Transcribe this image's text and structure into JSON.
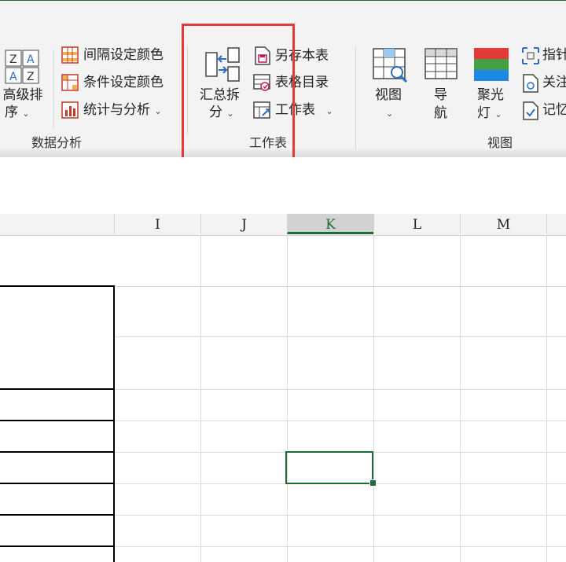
{
  "ribbon": {
    "groups": {
      "data_analysis": {
        "label": "数据分析",
        "sort": {
          "label_line1": "高级排",
          "label_line2": "序",
          "chevron": "⌄",
          "icon": "sort-az-icon"
        },
        "items": [
          {
            "label": "间隔设定颜色",
            "icon": "interval-color-icon"
          },
          {
            "label": "条件设定颜色",
            "icon": "condition-color-icon"
          },
          {
            "label": "统计与分析",
            "chevron": "⌄",
            "icon": "statistics-icon"
          }
        ]
      },
      "worksheet": {
        "label": "工作表",
        "summary_split": {
          "label_line1": "汇总拆",
          "label_line2": "分",
          "chevron": "⌄",
          "icon": "summary-split-icon"
        },
        "items": [
          {
            "label": "另存本表",
            "icon": "save-sheet-icon"
          },
          {
            "label": "表格目录",
            "icon": "table-directory-icon"
          },
          {
            "label": "工作表",
            "chevron": "⌄",
            "icon": "worksheet-icon"
          }
        ]
      },
      "view": {
        "label": "视图",
        "view_btn": {
          "label": "视图",
          "chevron": "⌄",
          "icon": "view-icon"
        },
        "nav_btn": {
          "label_line1": "导",
          "label_line2": "航",
          "icon": "navigation-grid-icon"
        },
        "spotlight_btn": {
          "label_line1": "聚光",
          "label_line2": "灯",
          "chevron": "⌄",
          "icon": "spotlight-icon"
        },
        "items": [
          {
            "label": "指针",
            "icon": "pointer-icon"
          },
          {
            "label": "关注",
            "icon": "follow-icon"
          },
          {
            "label": "记忆",
            "icon": "memory-icon"
          }
        ]
      }
    },
    "highlight_color": "#e53935"
  },
  "sheet": {
    "columns": [
      {
        "name": "I",
        "selected": false
      },
      {
        "name": "J",
        "selected": false
      },
      {
        "name": "K",
        "selected": true
      },
      {
        "name": "L",
        "selected": false
      },
      {
        "name": "M",
        "selected": false
      }
    ],
    "active_cell": "K",
    "accent_color": "#1e6b3a"
  }
}
